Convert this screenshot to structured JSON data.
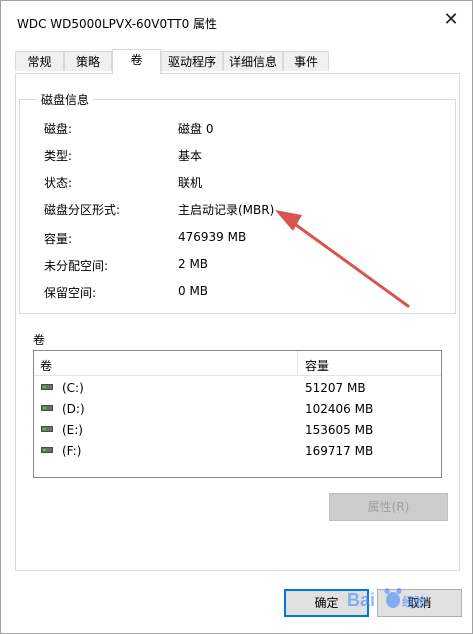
{
  "window": {
    "title": "WDC WD5000LPVX-60V0TT0 属性",
    "close_glyph": "✕"
  },
  "tabs": [
    {
      "label": "常规",
      "active": false
    },
    {
      "label": "策略",
      "active": false
    },
    {
      "label": "卷",
      "active": true
    },
    {
      "label": "驱动程序",
      "active": false
    },
    {
      "label": "详细信息",
      "active": false
    },
    {
      "label": "事件",
      "active": false
    }
  ],
  "disk_info": {
    "group_title": "磁盘信息",
    "rows": [
      {
        "label": "磁盘:",
        "value": "磁盘 0"
      },
      {
        "label": "类型:",
        "value": "基本"
      },
      {
        "label": "状态:",
        "value": "联机"
      },
      {
        "label": "磁盘分区形式:",
        "value": "主启动记录(MBR)"
      },
      {
        "label": "容量:",
        "value": "476939 MB"
      },
      {
        "label": "未分配空间:",
        "value": "2 MB"
      },
      {
        "label": "保留空间:",
        "value": "0 MB"
      }
    ]
  },
  "volumes": {
    "section_label": "卷",
    "columns": [
      "卷",
      "容量"
    ],
    "rows": [
      {
        "name": "(C:)",
        "capacity": "51207 MB",
        "icon": "drive-icon"
      },
      {
        "name": "(D:)",
        "capacity": "102406 MB",
        "icon": "drive-icon"
      },
      {
        "name": "(E:)",
        "capacity": "153605 MB",
        "icon": "drive-icon"
      },
      {
        "name": "(F:)",
        "capacity": "169717 MB",
        "icon": "drive-icon"
      }
    ]
  },
  "buttons": {
    "properties": "属性(R)",
    "ok": "确定",
    "cancel": "取消"
  },
  "colors": {
    "annotation_arrow": "#d9534f",
    "default_button_border": "#0078d7"
  }
}
